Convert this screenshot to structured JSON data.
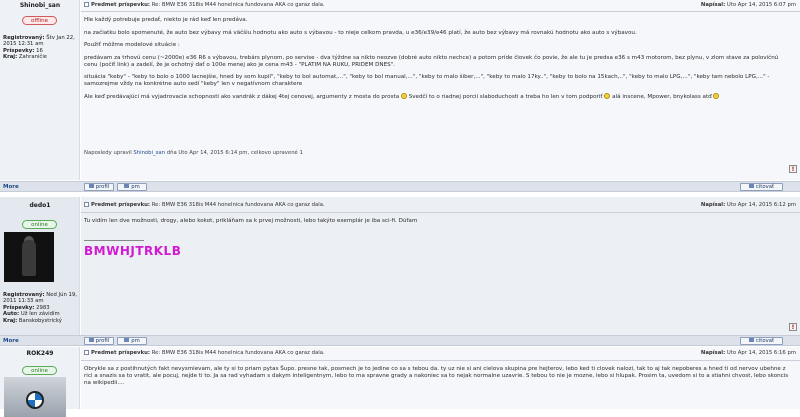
{
  "post1": {
    "author": "Shinobi_san",
    "status": "offline",
    "meta": {
      "registered_label": "Registrovaný:",
      "registered_value": "Štv Jan 22, 2015 12:31 am",
      "posts_label": "Príspevky:",
      "posts_value": "16",
      "location_label": "Kraj:",
      "location_value": "Zahraničie"
    },
    "subject_label": "Predmet príspevku:",
    "subject": "Re: BMW E36 318is M44 honelnica fundovana AKA co garaz dala.",
    "date_label": "Napísal:",
    "date": "Uto Apr 14, 2015 6:07 pm",
    "paragraphs": [
      "Hle každý potrebuje predať, niekto je rád keď len predáva.",
      "na začiatku bolo spomenuté, že auto bez výbavy má väčšiu hodnotu ako auto s výbavou - to nieje celkom pravda, u e36/e39/e46 platí, že auto bez výbavy má rovnakú hodnotu ako auto s výbavou.",
      "Použiť môžme modelové situácie :",
      "predávam za trhovú cenu (~2000e) e36 R6 s výbavou, trebárs plynom, po servise - dva týždne sa nikto neozve (dobré auto nikto nechce) a potom príde človek čo povie, že ale tu je predsa e36 s m43 motorom, bez plynu, v zlom stave za polovičnú cenu (počiť link) a zadelí, že je ochotný dať o 100e menej ako je cena m43 - \"PLATIM NA RUKU, PRIDEM DNES\".",
      "situácia \"keby\" - \"keby to bolo o 1000 lacnejšie, hned by som kupil\", \"keby to bol automat,...\", \"keby to bol manual,...\", \"keby to malo šiber,...\", \"keby to malo 17ky..\", \"keby to bolo na 15kach,..\", \"keby to malo LPG,...\", \"keby tam nebolo LPG,...\" - samozrejme vždy na konkrétne auto sedí \"keby\" len v negatívnom charaktere",
      "Ale keď predávajúci má vyjadrovacie schopnosti ako vandrák z dákej 4tej cenovej, argumenty z mosta do prosta",
      "Svedčí to o riadnej porcii slaboduchosti a treba ho len v tom podporiť",
      "alá inscene, Mpower, bnykolass atď"
    ],
    "edit_prefix": "Naposledy upravil",
    "edit_user": "Shinobi_san",
    "edit_suffix": "dňa Uto Apr 14, 2015 6:14 pm, celkovo upravené 1"
  },
  "post2": {
    "author": "dedo1",
    "status": "online",
    "meta": {
      "registered_label": "Registrovaný:",
      "registered_value": "Ned Jún 19, 2011 11:33 am",
      "posts_label": "Príspevky:",
      "posts_value": "2983",
      "car_label": "Auto:",
      "car_value": "Už len závidím",
      "location_label": "Kraj:",
      "location_value": "Banskobystrický"
    },
    "subject_label": "Predmet príspevku:",
    "subject": "Re: BMW E36 318is M44 honelnica fundovana AKA co garaz dala.",
    "date_label": "Napísal:",
    "date": "Uto Apr 14, 2015 6:12 pm",
    "text": "Tu vidím len dve možnosti, drogy, alebo kokot, prikláňam sa k prvej možnosti, lebo takýto exemplár je iba sci-fi. Dúfam",
    "signature": "BMWHJTRKLB"
  },
  "post3": {
    "author": "ROK249",
    "status": "online",
    "subject_label": "Predmet príspevku:",
    "subject": "Re: BMW E36 318is M44 honelnica fundovana AKA co garaz dala.",
    "date_label": "Napísal:",
    "date": "Uto Apr 14, 2015 6:16 pm",
    "text": "Obrykle sa z postihnutých fakt nevysmievam, ale ty si to priam pytas Šupo. presne tak, posmech je to jedine co sa s tebou da. ty uz nie si ani cielova skupina pre hejterov, lebo ked ti clovek nalozi, tak to aj tak nepoberes a hned ti od nervov ubehne z rici a snazis sa to vratit, ale pocuj, nejde ti to. Ja sa rad vyhadam s dakym inteligentnym, lebo to ma spravne grady a nakoniec sa to nejak normalne uzavrie. S tebou to nie je mozne, lebo si hlupak. Prosim ta, uvedom si to a stiahni chvost, lebo skoncis na wikipedii...."
  },
  "footer": {
    "more": "More",
    "profile": "profil",
    "pm": "pm",
    "quote": "citovať"
  }
}
